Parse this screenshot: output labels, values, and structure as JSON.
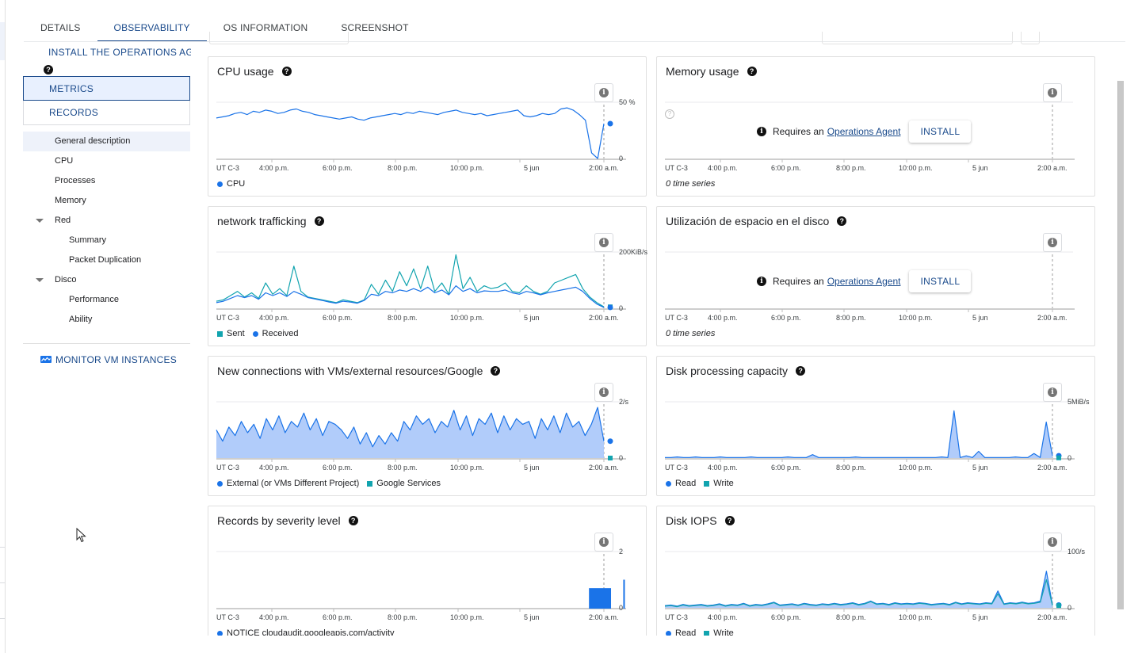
{
  "tabs": [
    {
      "label": "DETAILS",
      "active": false
    },
    {
      "label": "OBSERVABILITY",
      "active": true
    },
    {
      "label": "OS INFORMATION",
      "active": false
    },
    {
      "label": "SCREENSHOT",
      "active": false
    }
  ],
  "sidebar": {
    "install_agent_label": "INSTALL THE OPERATIONS AGENT",
    "help_icon": "help-circle-icon",
    "segments": [
      {
        "label": "METRICS",
        "active": true
      },
      {
        "label": "RECORDS",
        "active": false
      }
    ],
    "nav": [
      {
        "label": "General description",
        "level": 0,
        "active": true
      },
      {
        "label": "CPU",
        "level": 0
      },
      {
        "label": "Processes",
        "level": 0
      },
      {
        "label": "Memory",
        "level": 0
      },
      {
        "label": "Red",
        "level": 0,
        "expandable": true
      },
      {
        "label": "Summary",
        "level": 1
      },
      {
        "label": "Packet Duplication",
        "level": 1
      },
      {
        "label": "Disco",
        "level": 0,
        "expandable": true
      },
      {
        "label": "Performance",
        "level": 1
      },
      {
        "label": "Ability",
        "level": 1
      }
    ],
    "monitor_link": "MONITOR VM INSTANCES",
    "monitor_icon": "monitor-chart-icon"
  },
  "common": {
    "requires_text": "Requires an",
    "operations_agent_link": "Operations Agent",
    "install_button": "INSTALL",
    "zero_series": "0 time series",
    "x_ticks": [
      "UT C-3",
      "4:00 p.m.",
      "6:00 p.m.",
      "8:00 p.m.",
      "10:00 p.m.",
      "5 jun",
      "2:00 a.m."
    ]
  },
  "colors": {
    "accent": "#1a4a8b",
    "series_blue": "#1a73e8",
    "series_teal": "#12a4af",
    "area_fill": "#a8c7fa"
  },
  "chart_data": [
    {
      "id": "cpu",
      "type": "line",
      "title": "CPU usage",
      "ylabel_top": "50 %",
      "ylabel_bottom": "0",
      "ylim": [
        0,
        50
      ],
      "x_ticks": [
        "UT C-3",
        "4:00 p.m.",
        "6:00 p.m.",
        "8:00 p.m.",
        "10:00 p.m.",
        "5 jun",
        "2:00 a.m."
      ],
      "series": [
        {
          "name": "CPU",
          "color": "#1a73e8",
          "marker": "dot",
          "values": [
            36,
            37,
            38,
            40,
            41,
            39,
            42,
            41,
            43,
            42,
            40,
            41,
            43,
            44,
            42,
            41,
            39,
            38,
            37,
            36,
            35,
            36,
            37,
            35,
            34,
            36,
            37,
            38,
            39,
            40,
            39,
            41,
            40,
            42,
            41,
            40,
            39,
            41,
            42,
            43,
            41,
            40,
            39,
            40,
            38,
            39,
            40,
            41,
            42,
            43,
            38,
            37,
            38,
            40,
            39,
            40,
            44,
            45,
            43,
            39,
            34,
            5,
            0,
            31
          ]
        }
      ],
      "legend": [
        {
          "name": "CPU",
          "shape": "dot",
          "color": "#1a73e8"
        }
      ]
    },
    {
      "id": "memory",
      "type": "line",
      "title": "Memory usage",
      "empty": true,
      "x_ticks": [
        "UT C-3",
        "4:00 p.m.",
        "6:00 p.m.",
        "8:00 p.m.",
        "10:00 p.m.",
        "5 jun",
        "2:00 a.m."
      ],
      "series": []
    },
    {
      "id": "network",
      "type": "line",
      "title": "network trafficking",
      "ylabel_top": "200KiB/s",
      "ylabel_bottom": "0",
      "ylim": [
        0,
        200
      ],
      "x_ticks": [
        "UT C-3",
        "4:00 p.m.",
        "6:00 p.m.",
        "8:00 p.m.",
        "10:00 p.m.",
        "5 jun",
        "2:00 a.m."
      ],
      "series": [
        {
          "name": "Sent",
          "color": "#12a4af",
          "marker": "square",
          "values": [
            25,
            30,
            45,
            60,
            40,
            55,
            35,
            90,
            50,
            70,
            45,
            150,
            60,
            40,
            35,
            30,
            25,
            20,
            30,
            25,
            20,
            30,
            85,
            50,
            100,
            60,
            130,
            80,
            140,
            70,
            150,
            60,
            90,
            50,
            190,
            70,
            110,
            60,
            80,
            70,
            75,
            90,
            60,
            55,
            80,
            60,
            50,
            60,
            90,
            100,
            110,
            120,
            70,
            40,
            20,
            5
          ]
        },
        {
          "name": "Received",
          "color": "#1a73e8",
          "marker": "dot",
          "values": [
            20,
            25,
            35,
            45,
            38,
            45,
            32,
            55,
            45,
            55,
            42,
            60,
            50,
            38,
            33,
            28,
            22,
            18,
            25,
            22,
            18,
            28,
            50,
            45,
            60,
            55,
            65,
            60,
            70,
            60,
            75,
            55,
            65,
            48,
            80,
            60,
            70,
            55,
            62,
            60,
            60,
            65,
            55,
            50,
            60,
            55,
            48,
            55,
            60,
            65,
            70,
            75,
            60,
            35,
            15,
            3
          ]
        }
      ],
      "legend": [
        {
          "name": "Sent",
          "shape": "square",
          "color": "#12a4af"
        },
        {
          "name": "Received",
          "shape": "dot",
          "color": "#1a73e8"
        }
      ]
    },
    {
      "id": "disk-space",
      "type": "line",
      "title": "Utilización de espacio en el disco",
      "empty": true,
      "x_ticks": [
        "UT C-3",
        "4:00 p.m.",
        "6:00 p.m.",
        "8:00 p.m.",
        "10:00 p.m.",
        "5 jun",
        "2:00 a.m."
      ],
      "series": []
    },
    {
      "id": "connections",
      "type": "area",
      "title": "New connections with VMs/external resources/Google",
      "ylabel_top": "2/s",
      "ylabel_bottom": "0",
      "ylim": [
        0,
        2
      ],
      "x_ticks": [
        "UT C-3",
        "4:00 p.m.",
        "6:00 p.m.",
        "8:00 p.m.",
        "10:00 p.m.",
        "5 jun",
        "2:00 a.m."
      ],
      "series": [
        {
          "name": "External (or VMs Different Project)",
          "color": "#1a73e8",
          "marker": "dot",
          "values": [
            1.0,
            0.6,
            1.1,
            0.8,
            1.3,
            0.9,
            1.2,
            0.7,
            1.4,
            1.0,
            1.5,
            0.9,
            1.3,
            1.1,
            1.6,
            1.0,
            1.4,
            0.8,
            1.3,
            1.2,
            1.0,
            0.7,
            1.1,
            0.5,
            0.9,
            0.4,
            0.8,
            0.5,
            0.9,
            0.6,
            1.3,
            1.0,
            1.5,
            1.2,
            1.4,
            0.9,
            1.3,
            1.1,
            1.7,
            1.0,
            1.5,
            0.8,
            1.4,
            1.2,
            1.6,
            0.9,
            1.5,
            1.0,
            1.4,
            1.2,
            1.3,
            0.7,
            1.4,
            1.0,
            1.5,
            0.9,
            1.6,
            1.1,
            1.3,
            0.8,
            1.2,
            1.8,
            0.6
          ]
        },
        {
          "name": "Google Services",
          "color": "#12a4af",
          "marker": "square",
          "values": [
            0
          ]
        }
      ],
      "legend": [
        {
          "name": "External (or VMs Different Project)",
          "shape": "dot",
          "color": "#1a73e8"
        },
        {
          "name": "Google Services",
          "shape": "square",
          "color": "#12a4af"
        }
      ]
    },
    {
      "id": "disk-throughput",
      "type": "area",
      "title": "Disk processing capacity",
      "ylabel_top": "5MiB/s",
      "ylabel_bottom": "0",
      "ylim": [
        0,
        5
      ],
      "x_ticks": [
        "UT C-3",
        "4:00 p.m.",
        "6:00 p.m.",
        "8:00 p.m.",
        "10:00 p.m.",
        "5 jun",
        "2:00 a.m."
      ],
      "series": [
        {
          "name": "Read",
          "color": "#1a73e8",
          "marker": "dot",
          "values": [
            0.05,
            0.05,
            0.1,
            0.05,
            0.05,
            0.1,
            0.05,
            0.05,
            0.05,
            0.1,
            0.05,
            0.05,
            0.05,
            0.05,
            0.1,
            0.05,
            0.05,
            0.05,
            0.05,
            0.05,
            0.1,
            0.05,
            0.05,
            0.05,
            0.3,
            0.05,
            0.05,
            0.05,
            0.05,
            0.05,
            0.05,
            0.1,
            0.05,
            0.05,
            0.05,
            0.05,
            0.05,
            0.05,
            0.05,
            0.05,
            0.05,
            0.05,
            0.05,
            0.05,
            0.05,
            0.1,
            0.05,
            4.2,
            0.05,
            0.2,
            0.05,
            0.6,
            0.05,
            0.05,
            0.05,
            0.05,
            0.05,
            0.1,
            0.05,
            0.05,
            0.4,
            0.05,
            3.2,
            0.2
          ]
        },
        {
          "name": "Write",
          "color": "#12a4af",
          "marker": "square",
          "values": [
            0.02
          ]
        }
      ],
      "legend": [
        {
          "name": "Read",
          "shape": "dot",
          "color": "#1a73e8"
        },
        {
          "name": "Write",
          "shape": "square",
          "color": "#12a4af"
        }
      ]
    },
    {
      "id": "severity",
      "type": "bar",
      "title": "Records by severity level",
      "ylabel_top": "2",
      "ylabel_bottom": "0",
      "ylim": [
        0,
        2
      ],
      "x_ticks": [
        "UT C-3",
        "4:00 p.m.",
        "6:00 p.m.",
        "8:00 p.m.",
        "10:00 p.m.",
        "5 jun",
        "2:00 a.m."
      ],
      "bars": [
        {
          "x_start": 0.913,
          "x_end": 0.967,
          "value": 0.7
        },
        {
          "x_start": 0.997,
          "x_end": 1.0,
          "value": 1.0
        }
      ],
      "series": [
        {
          "name": "NOTICE cloudaudit.googleapis.com/activity",
          "color": "#1a73e8"
        }
      ],
      "legend": [
        {
          "name": "NOTICE cloudaudit.googleapis.com/activity",
          "shape": "dot",
          "color": "#1a73e8"
        }
      ]
    },
    {
      "id": "disk-iops",
      "type": "area",
      "title": "Disk IOPS",
      "ylabel_top": "100/s",
      "ylabel_bottom": "0",
      "ylim": [
        0,
        100
      ],
      "x_ticks": [
        "UT C-3",
        "4:00 p.m.",
        "6:00 p.m.",
        "8:00 p.m.",
        "10:00 p.m.",
        "5 jun",
        "2:00 a.m."
      ],
      "series": [
        {
          "name": "Read",
          "color": "#1a73e8",
          "marker": "dot",
          "values": [
            4,
            5,
            3,
            6,
            4,
            5,
            6,
            4,
            5,
            7,
            4,
            6,
            5,
            8,
            4,
            6,
            5,
            7,
            10,
            5,
            6,
            7,
            5,
            8,
            6,
            5,
            7,
            6,
            8,
            6,
            7,
            9,
            6,
            8,
            12,
            7,
            8,
            6,
            9,
            7,
            8,
            7,
            9,
            8,
            6,
            7,
            8,
            6,
            10,
            7,
            9,
            8,
            7,
            9,
            8,
            30,
            7,
            9,
            8,
            10,
            8,
            9,
            12,
            65,
            5
          ]
        },
        {
          "name": "Write",
          "color": "#12a4af",
          "marker": "square",
          "values": [
            3,
            4,
            2,
            5,
            3,
            4,
            5,
            3,
            4,
            6,
            3,
            5,
            4,
            7,
            3,
            5,
            4,
            6,
            9,
            4,
            5,
            6,
            4,
            7,
            5,
            4,
            6,
            5,
            7,
            5,
            6,
            8,
            5,
            7,
            11,
            6,
            7,
            5,
            8,
            6,
            7,
            6,
            8,
            7,
            5,
            6,
            7,
            5,
            9,
            6,
            8,
            7,
            6,
            8,
            7,
            25,
            6,
            8,
            7,
            9,
            7,
            8,
            10,
            50,
            4
          ]
        }
      ],
      "legend": [
        {
          "name": "Read",
          "shape": "dot",
          "color": "#1a73e8"
        },
        {
          "name": "Write",
          "shape": "square",
          "color": "#12a4af"
        }
      ]
    }
  ]
}
